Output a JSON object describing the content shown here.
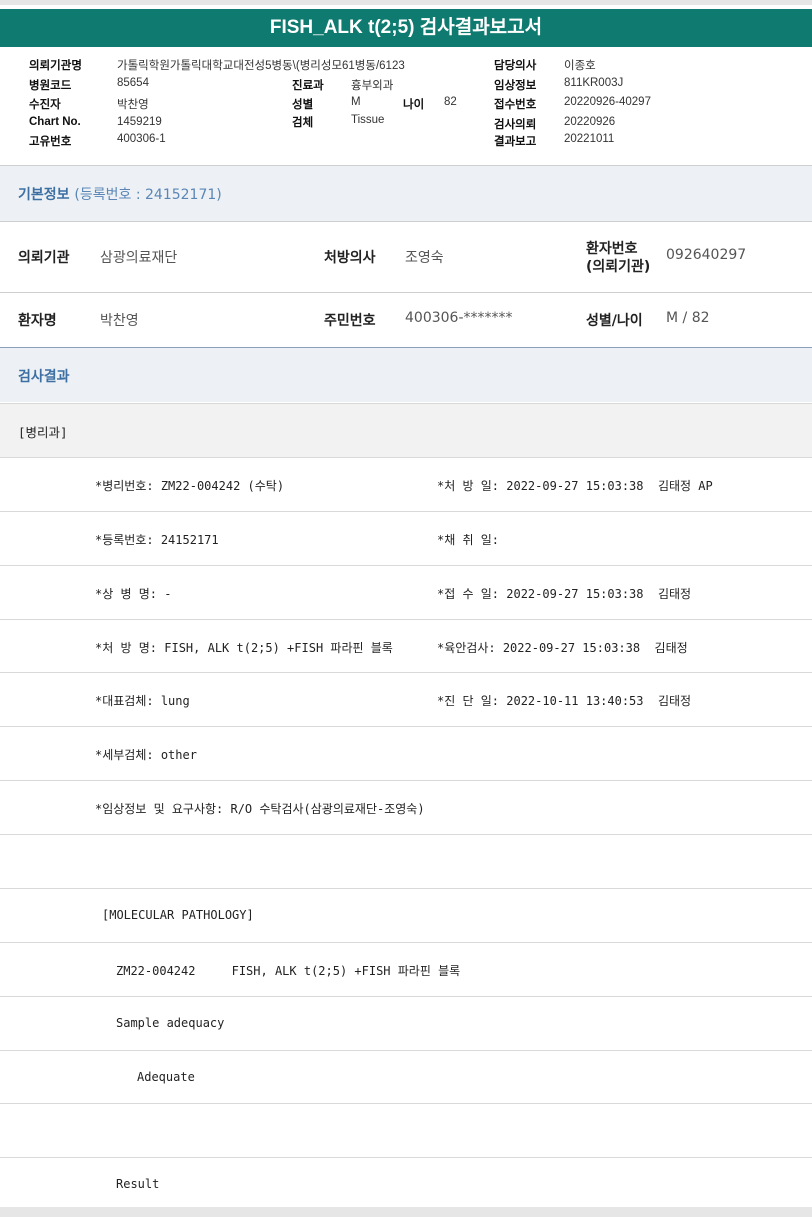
{
  "title": "FISH_ALK t(2;5) 검사결과보고서",
  "header": {
    "ordering_org_label": "의뢰기관명",
    "ordering_org_value": "가톨릭학원가톨릭대학교대전성5병동\\(병리성모61병동/6123",
    "hospital_code_label": "병원코드",
    "hospital_code_value": "85654",
    "dept_label": "진료과",
    "dept_value": "흉부외과",
    "recipient_label": "수진자",
    "recipient_value": "박찬영",
    "sex_label": "성별",
    "sex_value": "M",
    "age_label": "나이",
    "age_value": "82",
    "chart_label": "Chart No.",
    "chart_value": "1459219",
    "specimen_label": "검체",
    "specimen_value": "Tissue",
    "unique_label": "고유번호",
    "unique_value": "400306-1",
    "doctor_label": "담당의사",
    "doctor_value": "이종호",
    "clinical_label": "임상정보",
    "clinical_value": "811KR003J",
    "receipt_label": "접수번호",
    "receipt_value": "20220926-40297",
    "request_label": "검사의뢰",
    "request_value": "20220926",
    "report_label": "결과보고",
    "report_value": "20221011"
  },
  "basic_info": {
    "title": "기본정보",
    "reg_text": "(등록번호 : 24152171)",
    "org_label": "의뢰기관",
    "org_value": "삼광의료재단",
    "prescriber_label": "처방의사",
    "prescriber_value": "조영숙",
    "patno_label_1": "환자번호",
    "patno_label_2": "(의뢰기관)",
    "patno_value": "092640297",
    "name_label": "환자명",
    "name_value": "박찬영",
    "rrn_label": "주민번호",
    "rrn_value": "400306-*******",
    "sexage_label": "성별/나이",
    "sexage_value": "M / 82"
  },
  "results": {
    "title": "검사결과",
    "dept_tag": "[병리과]",
    "rows": [
      {
        "left": "*병리번호: ZM22-004242 (수탁)",
        "right": "*처 방 일: 2022-09-27 15:03:38  김태정 AP"
      },
      {
        "left": "*등록번호: 24152171",
        "right": "*채 취 일:"
      },
      {
        "left": "*상 병 명: -",
        "right": "*접 수 일: 2022-09-27 15:03:38  김태정"
      },
      {
        "left": "*처 방 명: FISH, ALK t(2;5) +FISH 파라핀 블록",
        "right": "*육안검사: 2022-09-27 15:03:38  김태정"
      },
      {
        "left": "*대표검체: lung",
        "right": "*진 단 일: 2022-10-11 13:40:53  김태정"
      },
      {
        "left": "*세부검체: other",
        "right": ""
      },
      {
        "left": "*임상정보 및 요구사항: R/O 수탁검사(삼광의료재단-조영숙)",
        "right": ""
      }
    ],
    "molecular_header": "[MOLECULAR PATHOLOGY]",
    "test_line": "ZM22-004242     FISH, ALK t(2;5) +FISH 파라핀 블록",
    "sample_adequacy": "Sample adequacy",
    "adequate": "Adequate",
    "result": "Result"
  }
}
